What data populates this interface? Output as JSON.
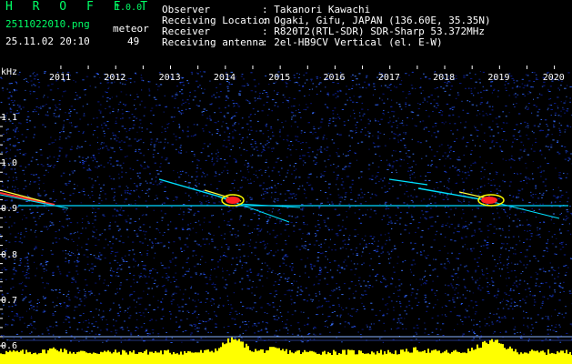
{
  "header": {
    "app_title": "H R O F F T",
    "version": "1.0.0",
    "filename": "2511022010.png",
    "meteor_label": "meteor",
    "datetime": "25.11.02 20:10",
    "meteor_count": "49",
    "info": [
      {
        "key": "Observer",
        "value": ": Takanori Kawachi"
      },
      {
        "key": "Receiving Location",
        "value": ": Ogaki, Gifu, JAPAN (136.60E, 35.35N)"
      },
      {
        "key": "Receiver",
        "value": ": R820T2(RTL-SDR) SDR-Sharp 53.372MHz"
      },
      {
        "key": "Receiving antenna",
        "value": ": 2el-HB9CV Vertical (el. E-W)"
      }
    ]
  },
  "colors": {
    "background": "#000000",
    "accent_green": "#00ff66",
    "noise_blue": "#0b1a7a",
    "signal_cyan": "#00e0ff",
    "signal_yellow": "#ffff00",
    "signal_red": "#ff2020",
    "activity_yellow": "#ffff00"
  },
  "chart_data": {
    "type": "heatmap",
    "title": "",
    "xlabel": "",
    "ylabel": "kHz",
    "x_tick_labels": [
      "2011",
      "2012",
      "2013",
      "2014",
      "2015",
      "2016",
      "2017",
      "2018",
      "2019",
      "2020"
    ],
    "y_tick_labels": [
      "1.1",
      "1.0",
      "0.9",
      "0.8",
      "0.7",
      "0.6"
    ],
    "y_ticks": [
      1.1,
      1.0,
      0.9,
      0.8,
      0.7,
      0.6
    ],
    "ylim": [
      0.58,
      1.19
    ],
    "carrier_khz": 0.907,
    "lower_marker_khz": 0.615
  }
}
